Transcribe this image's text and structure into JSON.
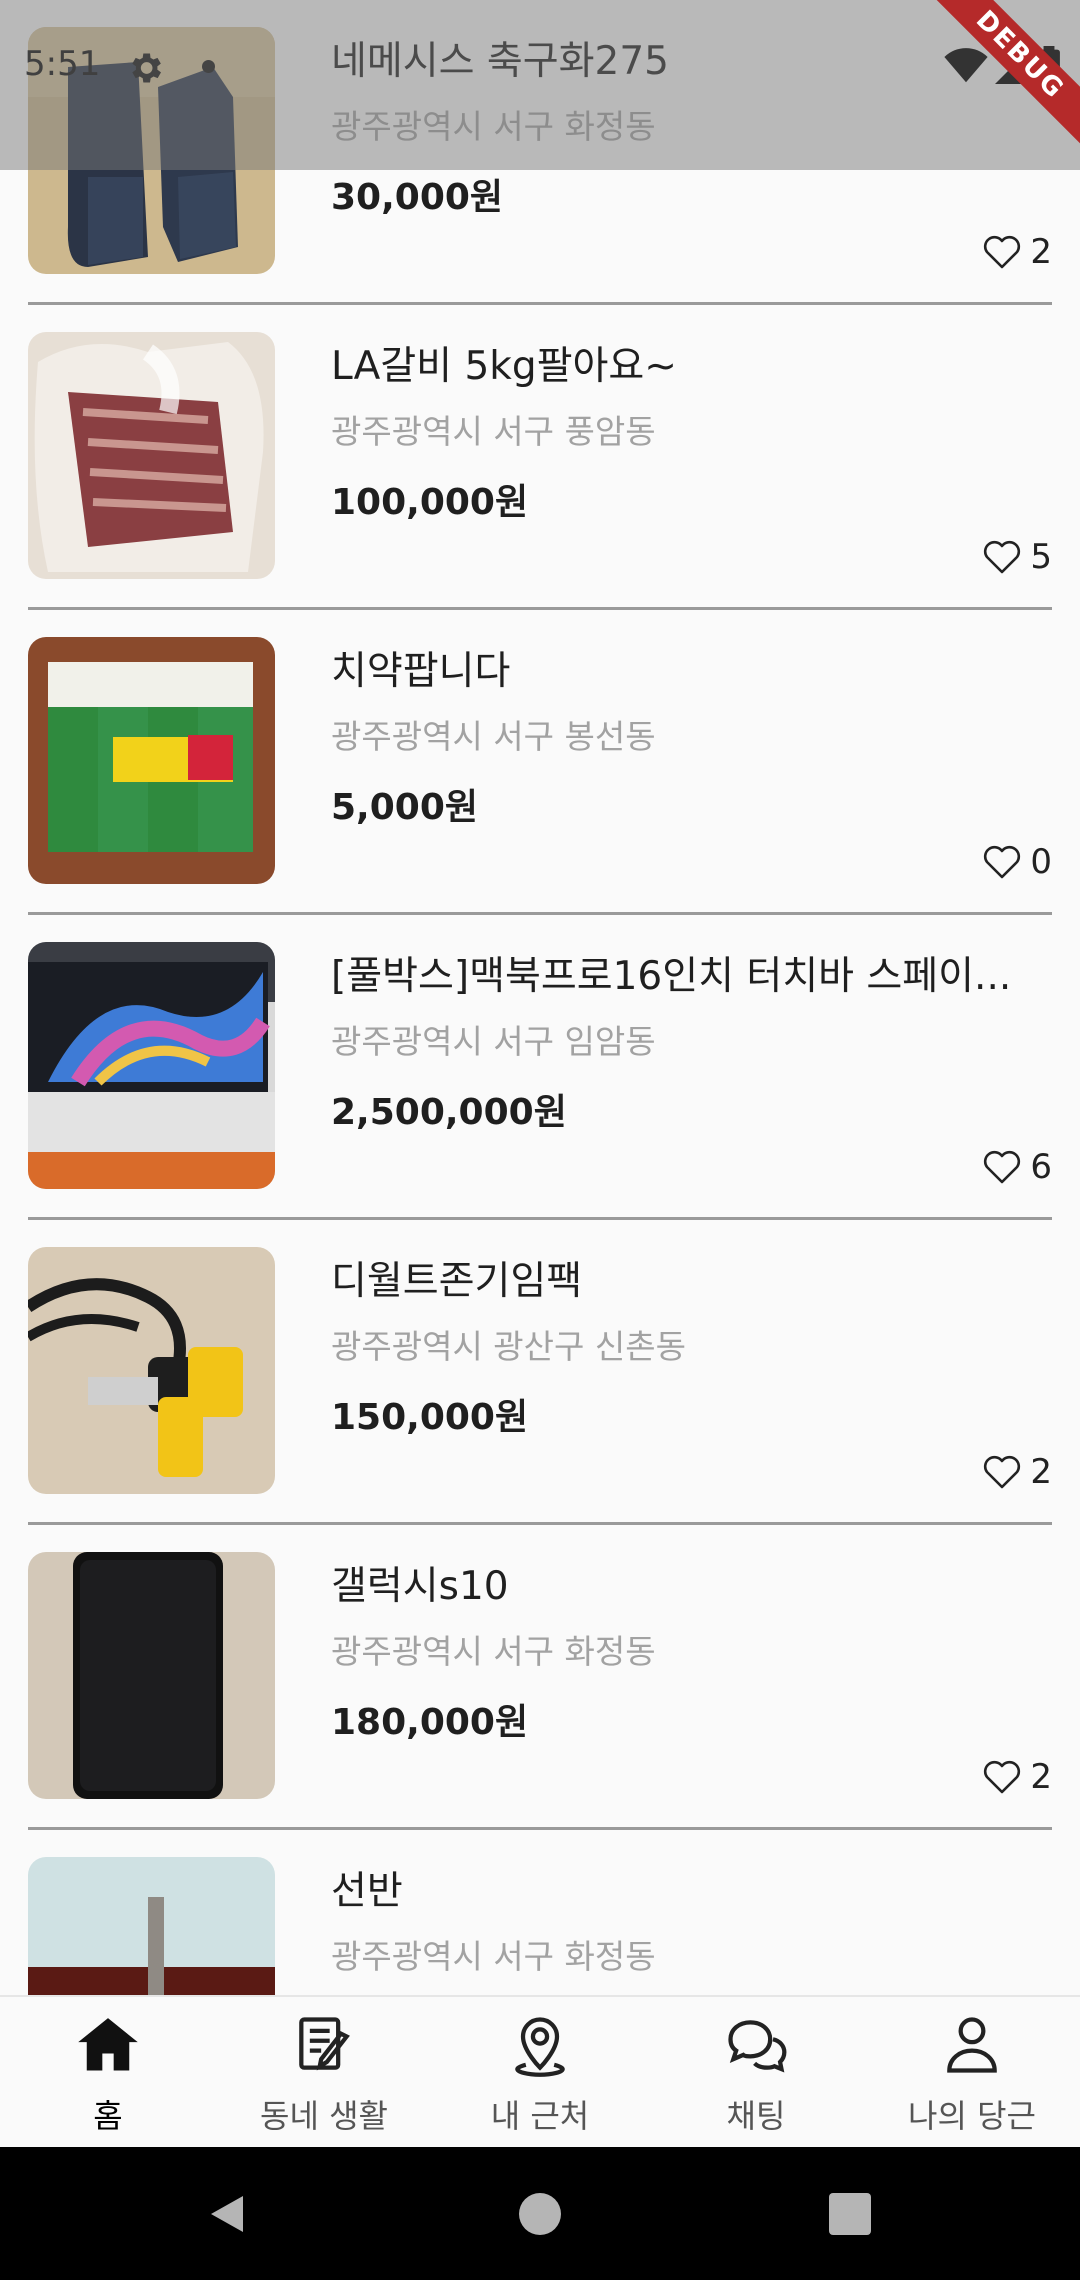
{
  "status_bar": {
    "time": "5:51",
    "debug_label": "DEBUG"
  },
  "listings": [
    {
      "title": "네메시스 축구화275",
      "location": "광주광역시 서구 화정동",
      "price": "30,000원",
      "likes": "2",
      "thumbnail": "navy-soccer-shoes"
    },
    {
      "title": "LA갈비 5kg팔아요~",
      "location": "광주광역시 서구 풍암동",
      "price": "100,000원",
      "likes": "5",
      "thumbnail": "beef-ribs"
    },
    {
      "title": "치약팝니다",
      "location": "광주광역시 서구 봉선동",
      "price": "5,000원",
      "likes": "0",
      "thumbnail": "toothpaste-pack"
    },
    {
      "title": "[풀박스]맥북프로16인치 터치바 스페이...",
      "location": "광주광역시 서구 임암동",
      "price": "2,500,000원",
      "likes": "6",
      "thumbnail": "macbook-pro"
    },
    {
      "title": "디월트존기임팩",
      "location": "광주광역시 광산구 신촌동",
      "price": "150,000원",
      "likes": "2",
      "thumbnail": "dewalt-impact-wrench"
    },
    {
      "title": "갤럭시s10",
      "location": "광주광역시 서구 화정동",
      "price": "180,000원",
      "likes": "2",
      "thumbnail": "black-smartphone"
    },
    {
      "title": "선반",
      "location": "광주광역시 서구 화정동",
      "price": "",
      "likes": "",
      "thumbnail": "shelf"
    }
  ],
  "bottom_nav": [
    {
      "label": "홈",
      "icon": "home-icon",
      "active": true
    },
    {
      "label": "동네 생활",
      "icon": "note-edit-icon",
      "active": false
    },
    {
      "label": "내 근처",
      "icon": "location-pin-icon",
      "active": false
    },
    {
      "label": "채팅",
      "icon": "chat-bubbles-icon",
      "active": false
    },
    {
      "label": "나의 당근",
      "icon": "person-icon",
      "active": false
    }
  ],
  "colors": {
    "divider": "#9a9a9a",
    "location_text": "#a2a2a2",
    "debug_banner": "#b52a2a"
  }
}
